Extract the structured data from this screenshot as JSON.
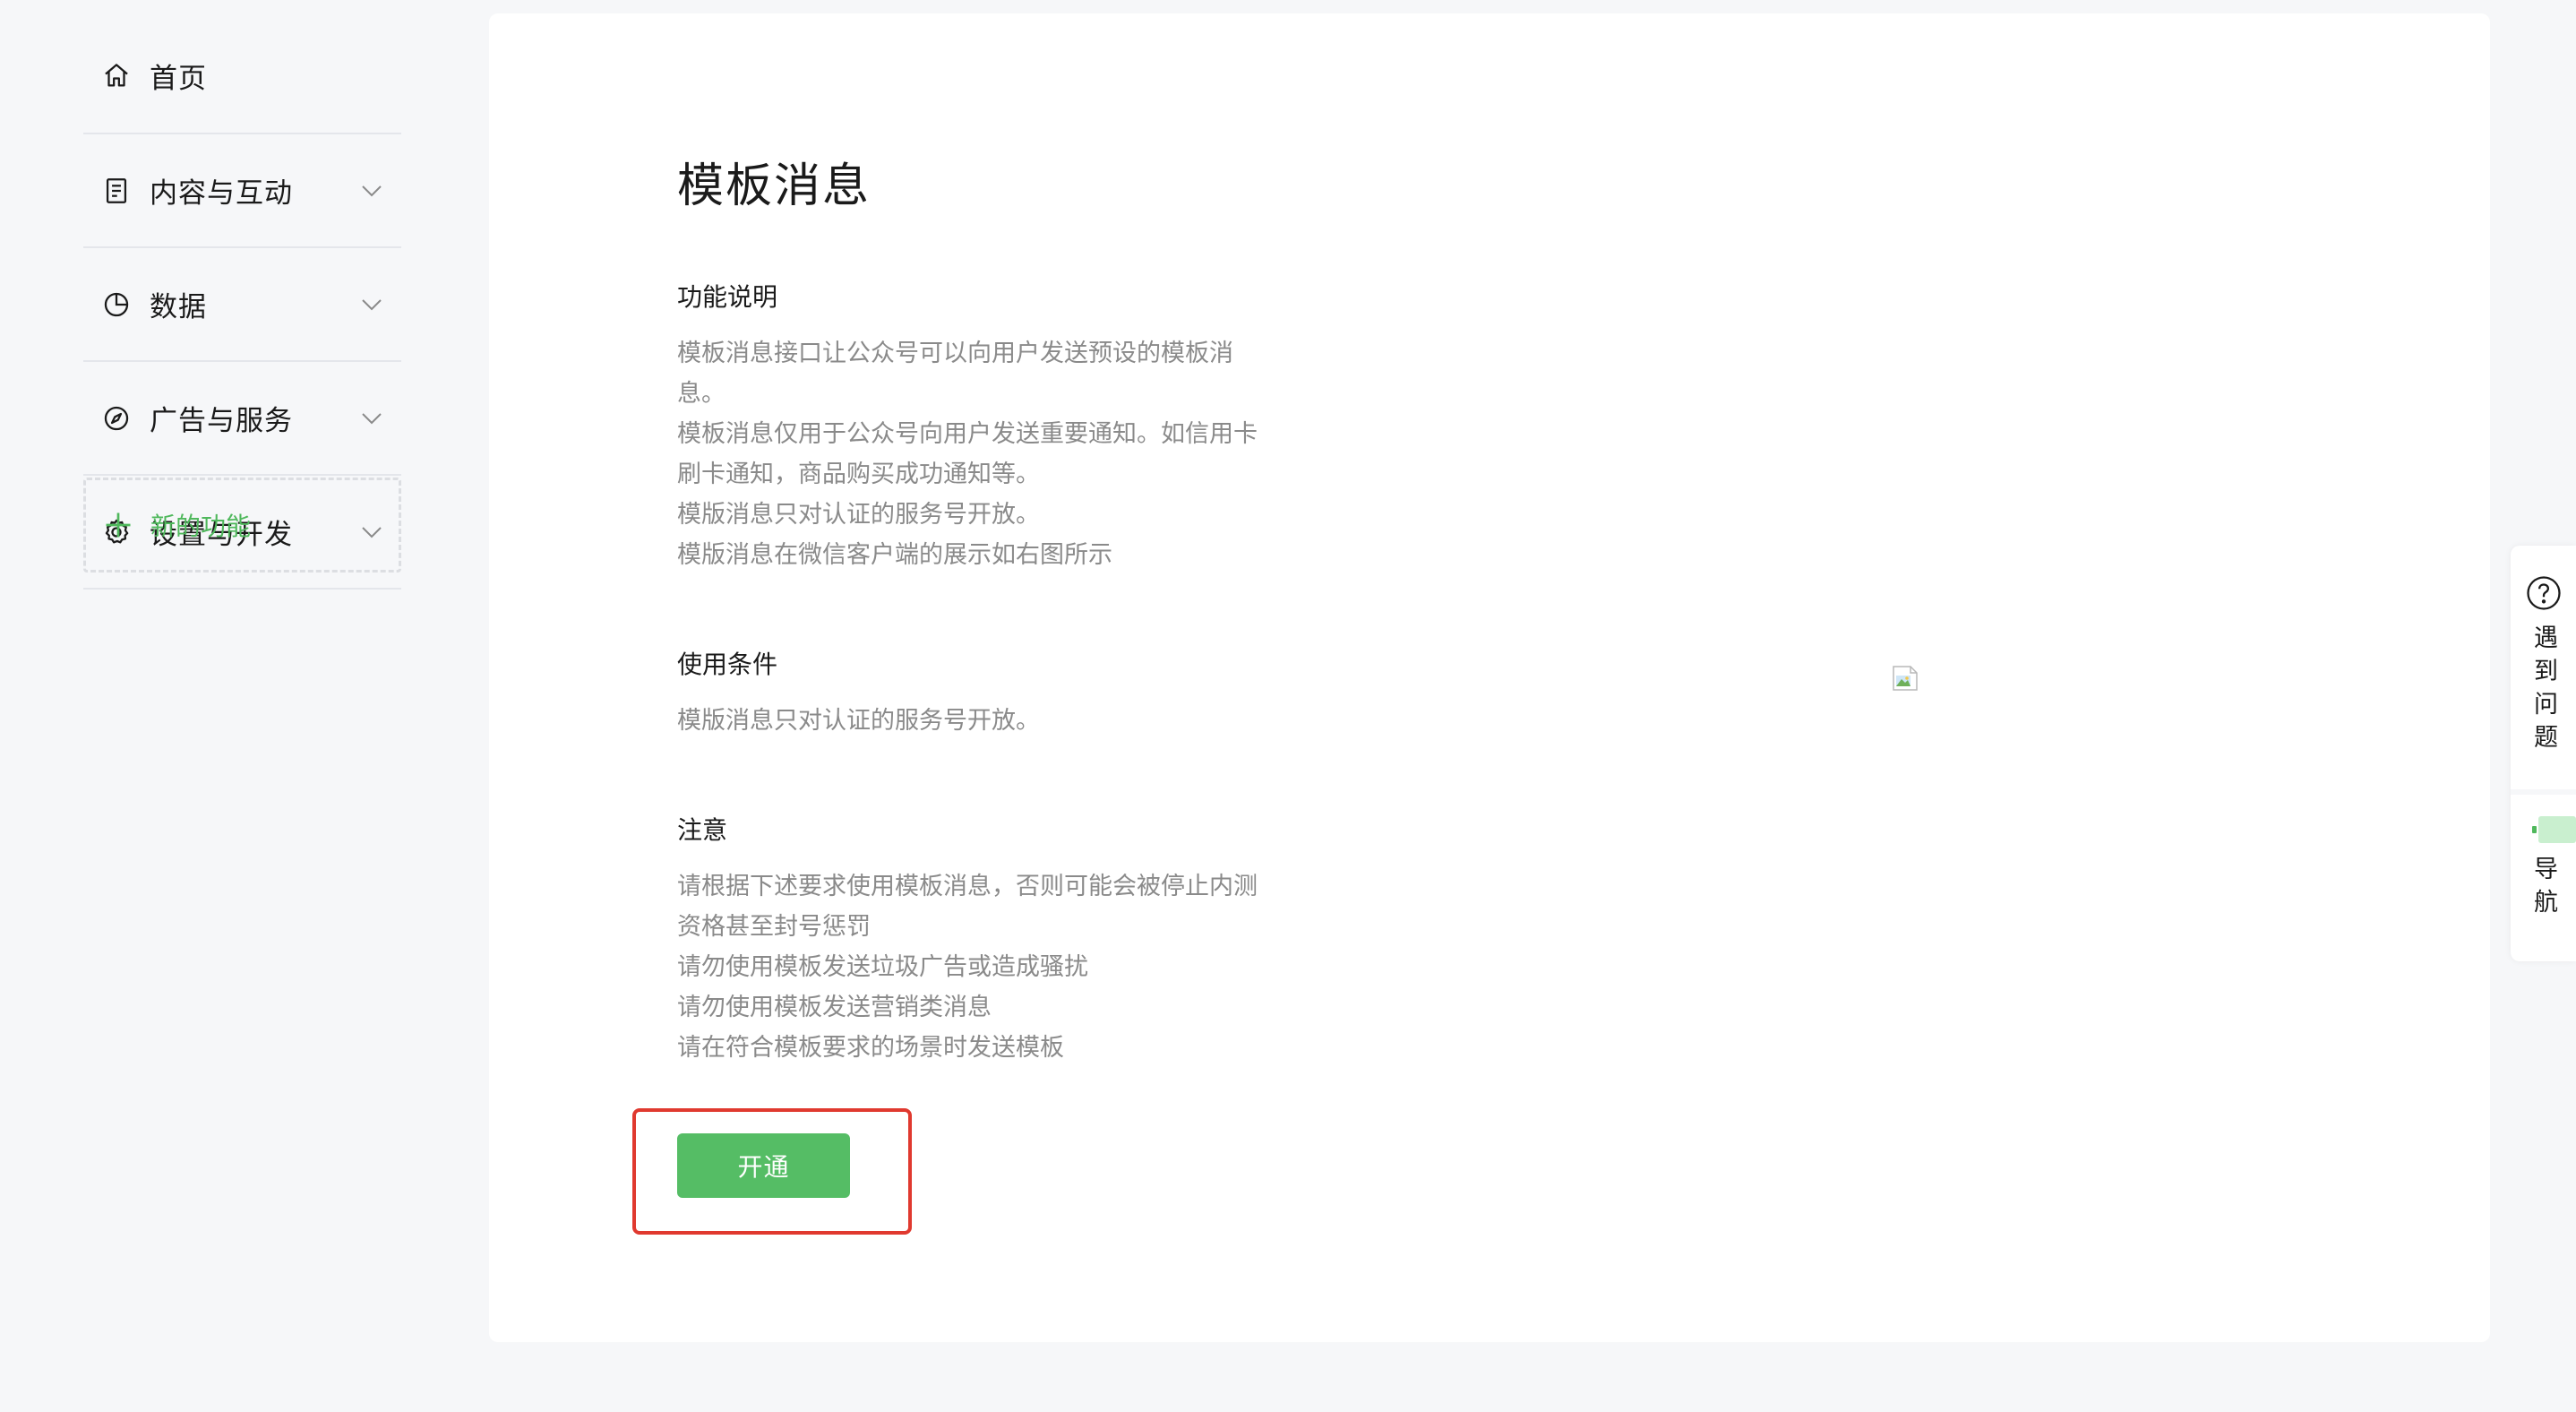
{
  "sidebar": {
    "items": [
      {
        "label": "首页",
        "icon": "home-icon",
        "has_chevron": false
      },
      {
        "label": "内容与互动",
        "icon": "document-icon",
        "has_chevron": true
      },
      {
        "label": "数据",
        "icon": "pie-chart-icon",
        "has_chevron": true
      },
      {
        "label": "广告与服务",
        "icon": "compass-icon",
        "has_chevron": true
      },
      {
        "label": "设置与开发",
        "icon": "gear-icon",
        "has_chevron": true
      }
    ],
    "new_feature": {
      "label": "新的功能",
      "icon": "plus-icon"
    }
  },
  "main": {
    "title": "模板消息",
    "sections": [
      {
        "title": "功能说明",
        "lines": [
          "模板消息接口让公众号可以向用户发送预设的模板消",
          "息。",
          "模板消息仅用于公众号向用户发送重要通知。如信用卡",
          "刷卡通知，商品购买成功通知等。",
          "模版消息只对认证的服务号开放。",
          "模版消息在微信客户端的展示如右图所示"
        ]
      },
      {
        "title": "使用条件",
        "lines": [
          "模版消息只对认证的服务号开放。"
        ]
      },
      {
        "title": "注意",
        "lines": [
          "请根据下述要求使用模板消息，否则可能会被停止内测",
          "资格甚至封号惩罚",
          "请勿使用模板发送垃圾广告或造成骚扰",
          "请勿使用模板发送营销类消息",
          "请在符合模板要求的场景时发送模板"
        ]
      }
    ],
    "open_button_label": "开通",
    "preview_image": "broken-image-icon"
  },
  "float_panel": {
    "help_label": "遇到问题",
    "help_icon": "question-circle-icon",
    "nav_label": "导航"
  },
  "colors": {
    "accent_green": "#55bd65",
    "highlight_red": "#e0392f",
    "muted_text": "#8a8a8a",
    "page_bg": "#f6f7f9"
  }
}
